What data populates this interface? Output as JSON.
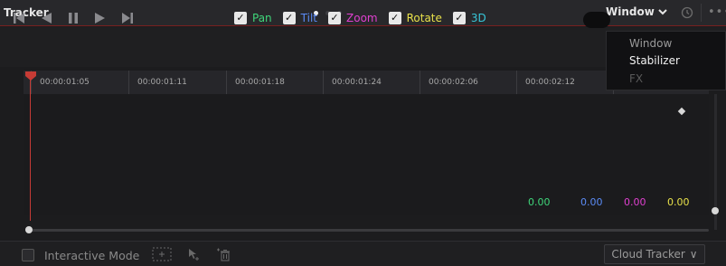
{
  "panel": {
    "title": "Tracker"
  },
  "header": {
    "mode_selected": "Window",
    "chevron": "▾",
    "more": "•••"
  },
  "transport": {
    "icons": [
      "skip-to-start-icon",
      "play-reverse-icon",
      "pause-icon",
      "play-forward-icon",
      "skip-to-end-icon"
    ]
  },
  "track_options": [
    {
      "label": "Pan",
      "checked": true,
      "color": "#3fd67a"
    },
    {
      "label": "Tilt",
      "checked": true,
      "color": "#5b8bf5"
    },
    {
      "label": "Zoom",
      "checked": true,
      "color": "#e040d0"
    },
    {
      "label": "Rotate",
      "checked": true,
      "color": "#e8e14a"
    },
    {
      "label": "3D",
      "checked": true,
      "color": "#37c6d8"
    }
  ],
  "ruler": {
    "timecodes": [
      "00:00:01:05",
      "00:00:01:11",
      "00:00:01:18",
      "00:00:01:24",
      "00:00:02:06",
      "00:00:02:12"
    ]
  },
  "values": [
    {
      "text": "0.00",
      "color": "#3fd67a"
    },
    {
      "text": "0.00",
      "color": "#5b8bf5"
    },
    {
      "text": "0.00",
      "color": "#e040d0"
    },
    {
      "text": "0.00",
      "color": "#e8e14a"
    }
  ],
  "footer": {
    "interactive_mode_label": "Interactive Mode",
    "interactive_mode_checked": false,
    "cloud_tracker_label": "Cloud Tracker",
    "chevron": "∨"
  },
  "mode_dropdown": {
    "items": [
      {
        "label": "Window",
        "state": "current"
      },
      {
        "label": "Stabilizer",
        "state": "highlighted"
      },
      {
        "label": "FX",
        "state": "disabled"
      }
    ]
  },
  "colors": {
    "accent_red": "#c63b35",
    "background": "#1c1c1e"
  }
}
